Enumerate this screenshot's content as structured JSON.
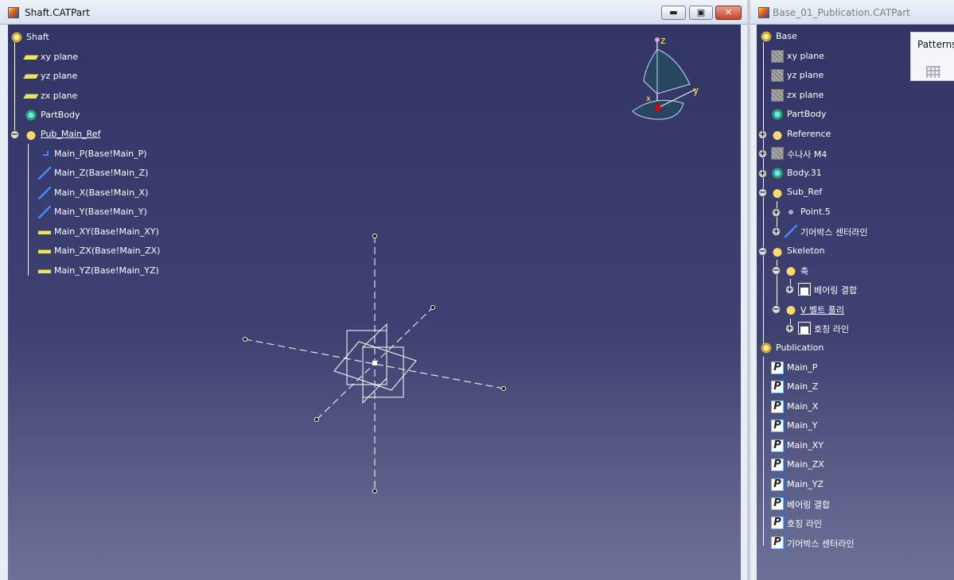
{
  "windows": {
    "left": {
      "title": "Shaft.CATPart",
      "buttons": {
        "minimize": "▬",
        "maximize": "▣",
        "close": "✕"
      },
      "tree": [
        {
          "label": "Shaft",
          "icon": "part-gear-icon"
        },
        {
          "label": "xy plane",
          "icon": "plane-icon"
        },
        {
          "label": "yz plane",
          "icon": "plane-icon"
        },
        {
          "label": "zx plane",
          "icon": "plane-icon"
        },
        {
          "label": "PartBody",
          "icon": "body-icon"
        },
        {
          "label": "Pub_Main_Ref",
          "icon": "reference-icon"
        },
        {
          "label": "Main_P(Base!Main_P)",
          "icon": "point-link-icon"
        },
        {
          "label": "Main_Z(Base!Main_Z)",
          "icon": "line-link-icon"
        },
        {
          "label": "Main_X(Base!Main_X)",
          "icon": "line-link-icon"
        },
        {
          "label": "Main_Y(Base!Main_Y)",
          "icon": "line-link-icon"
        },
        {
          "label": "Main_XY(Base!Main_XY)",
          "icon": "plane-link-icon"
        },
        {
          "label": "Main_ZX(Base!Main_ZX)",
          "icon": "plane-link-icon"
        },
        {
          "label": "Main_YZ(Base!Main_YZ)",
          "icon": "plane-link-icon"
        }
      ],
      "compass": {
        "z": "z",
        "y": "y",
        "x": "x"
      }
    },
    "right": {
      "title": "Base_01_Publication.CATPart",
      "tree": [
        {
          "label": "Base",
          "icon": "part-gear-icon"
        },
        {
          "label": "xy plane",
          "icon": "plane-icon"
        },
        {
          "label": "yz plane",
          "icon": "plane-icon"
        },
        {
          "label": "zx plane",
          "icon": "plane-icon"
        },
        {
          "label": "PartBody",
          "icon": "body-icon"
        },
        {
          "label": "Reference",
          "icon": "reference-icon"
        },
        {
          "label": "수나사 M4",
          "icon": "thread-icon"
        },
        {
          "label": "Body.31",
          "icon": "body-icon"
        },
        {
          "label": "Sub_Ref",
          "icon": "reference-icon"
        },
        {
          "label": "Point.5",
          "icon": "point-icon"
        },
        {
          "label": "기어박스 센터라인",
          "icon": "line-icon"
        },
        {
          "label": "Skeleton",
          "icon": "reference-icon"
        },
        {
          "label": "축",
          "icon": "reference-icon"
        },
        {
          "label": "베어링 결합",
          "icon": "sketch-icon"
        },
        {
          "label": "V 벨트 풀리",
          "icon": "reference-icon"
        },
        {
          "label": "호칭 라인",
          "icon": "sketch-icon"
        },
        {
          "label": "Publication",
          "icon": "publication-gear-icon"
        },
        {
          "label": "Main_P",
          "icon": "publication-icon"
        },
        {
          "label": "Main_Z",
          "icon": "publication-icon"
        },
        {
          "label": "Main_X",
          "icon": "publication-icon"
        },
        {
          "label": "Main_Y",
          "icon": "publication-icon"
        },
        {
          "label": "Main_XY",
          "icon": "publication-icon"
        },
        {
          "label": "Main_ZX",
          "icon": "publication-icon"
        },
        {
          "label": "Main_YZ",
          "icon": "publication-icon"
        },
        {
          "label": "베어링 결합",
          "icon": "publication-icon"
        },
        {
          "label": "호칭 라인",
          "icon": "publication-icon"
        },
        {
          "label": "기어박스 센터라인",
          "icon": "publication-icon"
        }
      ],
      "expanders": {
        "plus": "+",
        "minus": "−"
      }
    }
  },
  "toolbar": {
    "title": "Patterns",
    "icon": "pattern-grid-icon"
  },
  "colors": {
    "viewport_top": "#323566",
    "viewport_bottom": "#6e7197",
    "tree_text": "#ffffff"
  }
}
